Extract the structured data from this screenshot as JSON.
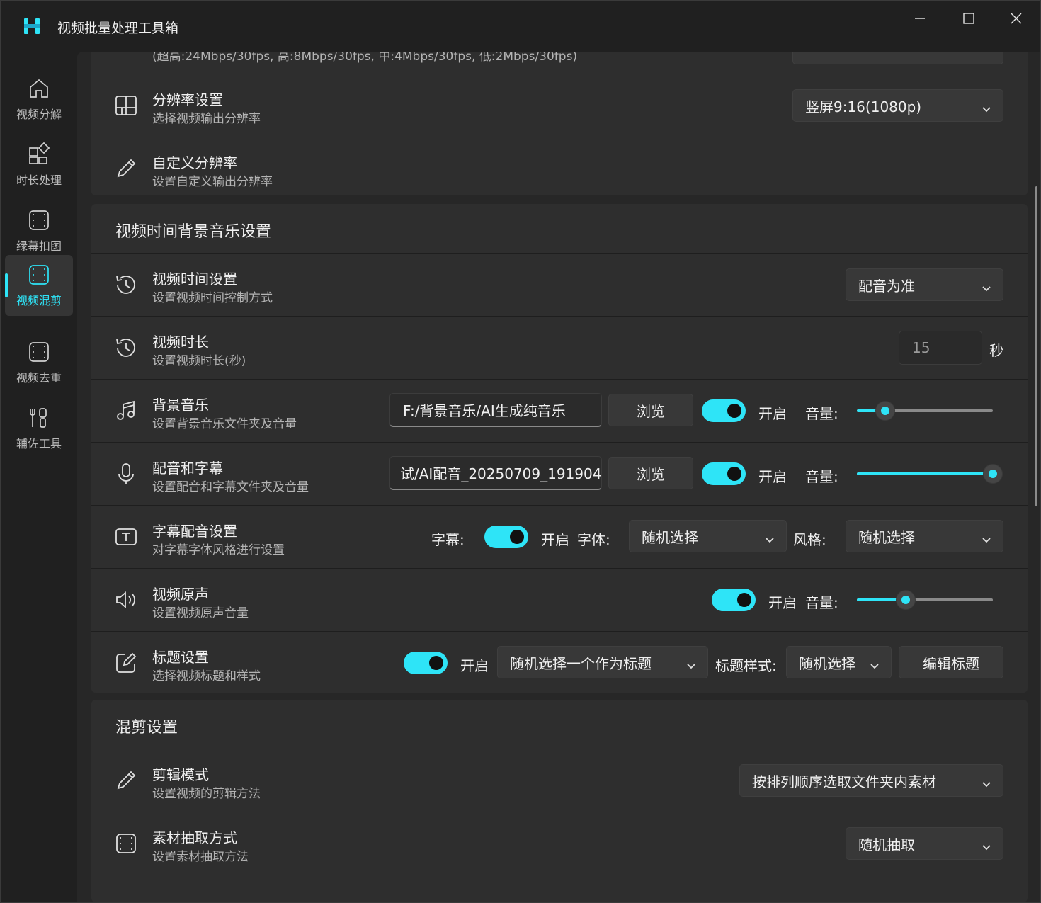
{
  "app": {
    "title": "视频批量处理工具箱"
  },
  "colors": {
    "accent": "#2ee4f7",
    "card": "#2e2e2e",
    "background": "#202020"
  },
  "sidebar": {
    "items": [
      {
        "label": "视频分解",
        "icon": "home-icon",
        "active": false
      },
      {
        "label": "时长处理",
        "icon": "apps-add-icon",
        "active": false
      },
      {
        "label": "绿幕扣图",
        "icon": "film-frame-icon",
        "active": false
      },
      {
        "label": "视频混剪",
        "icon": "film-frame-icon",
        "active": true
      },
      {
        "label": "视频去重",
        "icon": "film-frame-icon",
        "active": false
      },
      {
        "label": "辅佐工具",
        "icon": "tools-icon",
        "active": false
      }
    ]
  },
  "top_clipped": {
    "desc": "(超高:24Mbps/30fps, 高:8Mbps/30fps, 中:4Mbps/30fps, 低:2Mbps/30fps)"
  },
  "resolution": {
    "title": "分辨率设置",
    "desc": "选择视频输出分辨率",
    "value": "竖屏9:16(1080p)"
  },
  "custom_resolution": {
    "title": "自定义分辨率",
    "desc": "设置自定义输出分辨率"
  },
  "music_section": {
    "title": "视频时间背景音乐设置",
    "time_setting": {
      "title": "视频时间设置",
      "desc": "设置视频时间控制方式",
      "value": "配音为准"
    },
    "duration": {
      "title": "视频时长",
      "desc": "设置视频时长(秒)",
      "value": "15",
      "unit": "秒"
    },
    "bgm": {
      "title": "背景音乐",
      "desc": "设置背景音乐文件夹及音量",
      "path": "F:/背景音乐/AI生成纯音乐",
      "browse": "浏览",
      "toggle_label": "开启",
      "volume_label": "音量:",
      "volume": 0.21
    },
    "dubbing": {
      "title": "配音和字幕",
      "desc": "设置配音和字幕文件夹及音量",
      "path": "试/AI配音_20250709_191904",
      "browse": "浏览",
      "toggle_label": "开启",
      "volume_label": "音量:",
      "volume": 1.0
    },
    "subtitle": {
      "title": "字幕配音设置",
      "desc": "对字幕字体风格进行设置",
      "subtitle_label": "字幕:",
      "toggle_label": "开启",
      "font_label": "字体:",
      "font_value": "随机选择",
      "style_label": "风格:",
      "style_value": "随机选择"
    },
    "original_audio": {
      "title": "视频原声",
      "desc": "设置视频原声音量",
      "toggle_label": "开启",
      "volume_label": "音量:",
      "volume": 0.36
    },
    "title_setting": {
      "title": "标题设置",
      "desc": "选择视频标题和样式",
      "toggle_label": "开启",
      "mode_value": "随机选择一个作为标题",
      "style_label": "标题样式:",
      "style_value": "随机选择",
      "edit_button": "编辑标题"
    }
  },
  "mix_section": {
    "title": "混剪设置",
    "edit_mode": {
      "title": "剪辑模式",
      "desc": "设置视频的剪辑方法",
      "value": "按排列顺序选取文件夹内素材"
    },
    "extract": {
      "title": "素材抽取方式",
      "desc": "设置素材抽取方法",
      "value": "随机抽取"
    }
  }
}
